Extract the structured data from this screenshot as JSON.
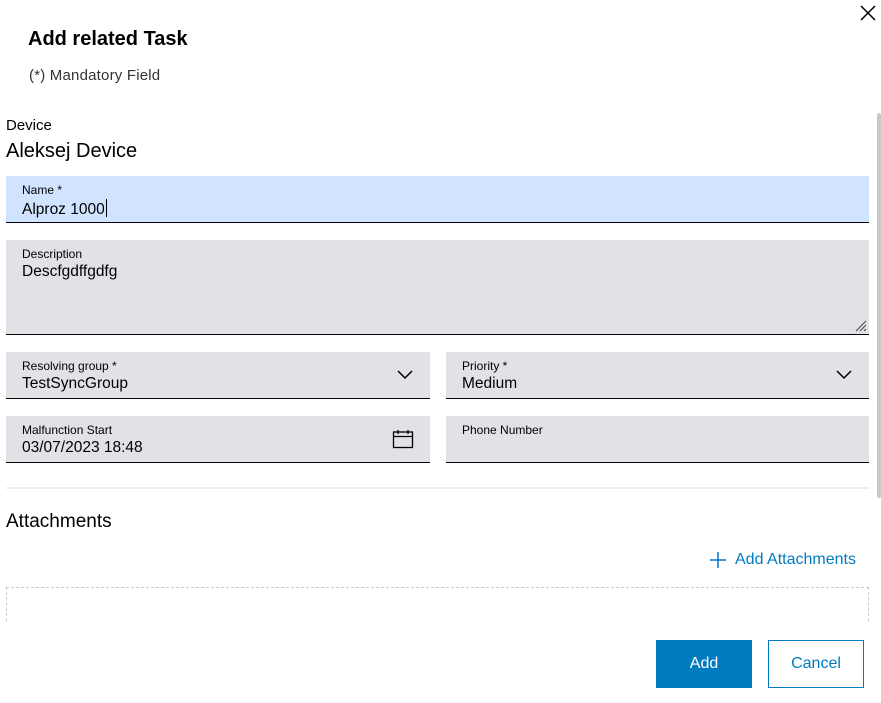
{
  "dialog": {
    "title": "Add related Task",
    "mandatory_note": "(*) Mandatory Field"
  },
  "device": {
    "label": "Device",
    "value": "Aleksej Device"
  },
  "form": {
    "name": {
      "label": "Name *",
      "value": "Alproz 1000"
    },
    "description": {
      "label": "Description",
      "value": "Descfgdffgdfg"
    },
    "resolving_group": {
      "label": "Resolving group *",
      "value": "TestSyncGroup"
    },
    "priority": {
      "label": "Priority *",
      "value": "Medium"
    },
    "malfunction_start": {
      "label": "Malfunction Start",
      "value": "03/07/2023 18:48"
    },
    "phone_number": {
      "label": "Phone Number",
      "value": ""
    }
  },
  "attachments": {
    "title": "Attachments",
    "add_label": "Add Attachments"
  },
  "actions": {
    "add_label": "Add",
    "cancel_label": "Cancel"
  },
  "icons": {
    "close": "close-icon",
    "dropdown": "chevron-down-icon",
    "calendar": "calendar-icon",
    "add": "plus-icon",
    "resize": "resize-handle-icon"
  },
  "colors": {
    "accent": "#007bc0",
    "field_bg": "#e1e2e6",
    "field_active_bg": "#d1e4ff"
  }
}
